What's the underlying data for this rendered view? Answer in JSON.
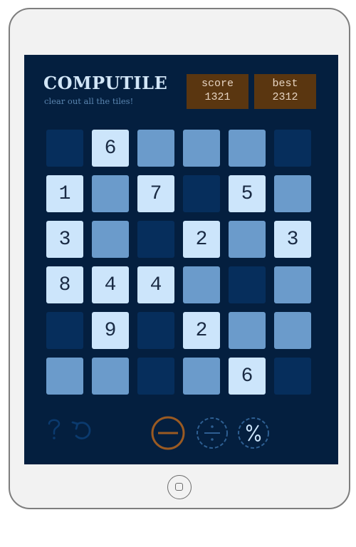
{
  "app": {
    "title": "COMPUTILE",
    "subtitle": "clear out all the tiles!"
  },
  "score": {
    "label": "score",
    "value": "1321"
  },
  "best": {
    "label": "best",
    "value": "2312"
  },
  "grid": [
    [
      {
        "state": "dark",
        "num": ""
      },
      {
        "state": "light",
        "num": "6"
      },
      {
        "state": "mid",
        "num": ""
      },
      {
        "state": "mid",
        "num": ""
      },
      {
        "state": "mid",
        "num": ""
      },
      {
        "state": "dark",
        "num": ""
      }
    ],
    [
      {
        "state": "light",
        "num": "1"
      },
      {
        "state": "mid",
        "num": ""
      },
      {
        "state": "light",
        "num": "7"
      },
      {
        "state": "dark",
        "num": ""
      },
      {
        "state": "light",
        "num": "5"
      },
      {
        "state": "mid",
        "num": ""
      }
    ],
    [
      {
        "state": "light",
        "num": "3"
      },
      {
        "state": "mid",
        "num": ""
      },
      {
        "state": "dark",
        "num": ""
      },
      {
        "state": "light",
        "num": "2"
      },
      {
        "state": "mid",
        "num": ""
      },
      {
        "state": "light",
        "num": "3"
      }
    ],
    [
      {
        "state": "light",
        "num": "8"
      },
      {
        "state": "light",
        "num": "4"
      },
      {
        "state": "light",
        "num": "4"
      },
      {
        "state": "mid",
        "num": ""
      },
      {
        "state": "dark",
        "num": ""
      },
      {
        "state": "mid",
        "num": ""
      }
    ],
    [
      {
        "state": "dark",
        "num": ""
      },
      {
        "state": "light",
        "num": "9"
      },
      {
        "state": "dark",
        "num": ""
      },
      {
        "state": "light",
        "num": "2"
      },
      {
        "state": "mid",
        "num": ""
      },
      {
        "state": "mid",
        "num": ""
      }
    ],
    [
      {
        "state": "mid",
        "num": ""
      },
      {
        "state": "mid",
        "num": ""
      },
      {
        "state": "dark",
        "num": ""
      },
      {
        "state": "mid",
        "num": ""
      },
      {
        "state": "light",
        "num": "6"
      },
      {
        "state": "dark",
        "num": ""
      }
    ]
  ],
  "toolbar": {
    "help_icon": "question-icon",
    "undo_icon": "undo-icon",
    "operations": [
      "minus-icon",
      "divide-icon",
      "percent-icon"
    ],
    "active_operation": "minus-icon"
  },
  "colors": {
    "screen": "#041f3f",
    "tile_dark": "#062e5c",
    "tile_mid": "#6b9bcb",
    "tile_light": "#cce5fb",
    "score_box": "#5a3610",
    "active_op": "#9a5a22"
  }
}
